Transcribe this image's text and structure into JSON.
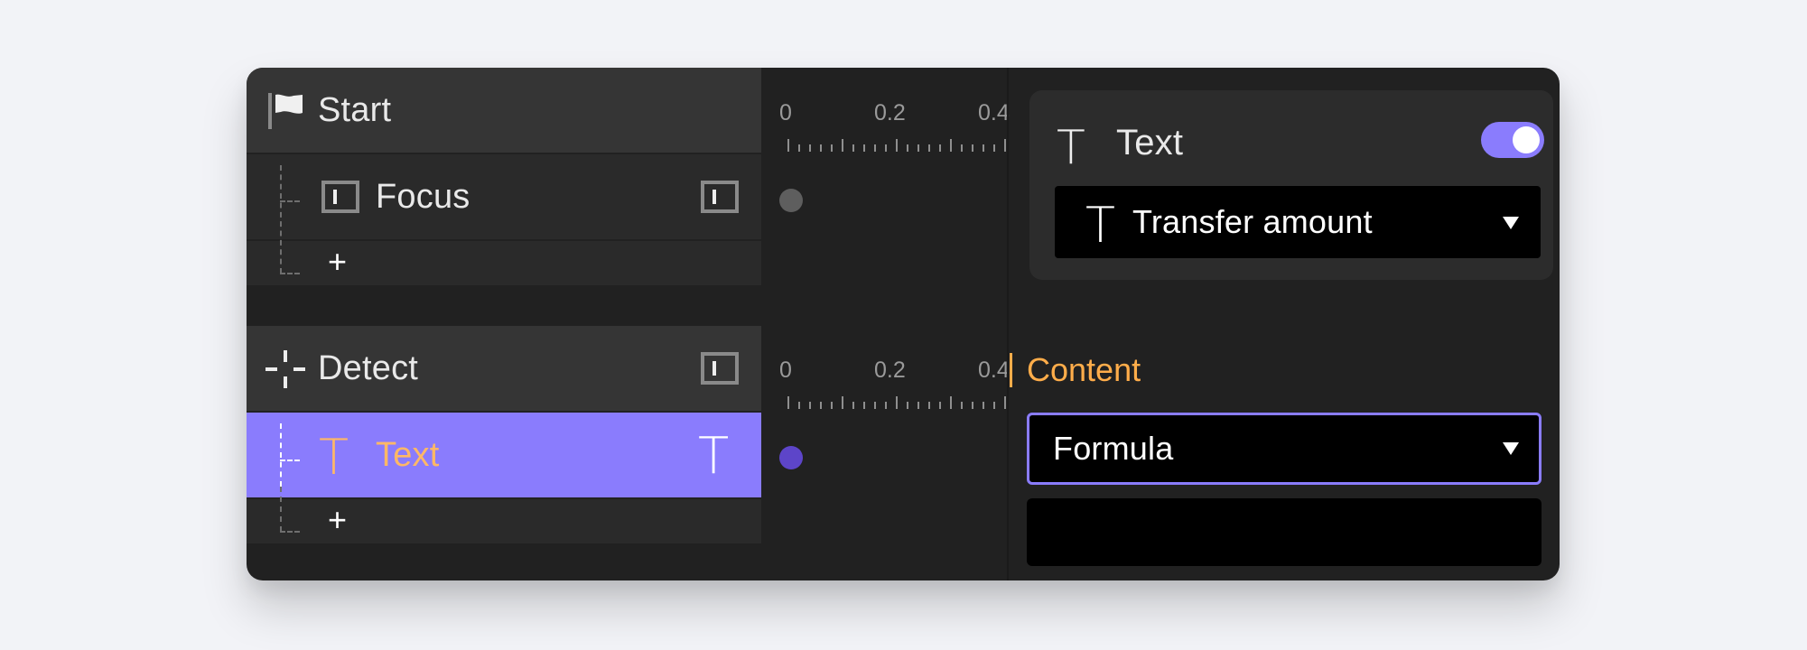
{
  "left_panel": {
    "groups": [
      {
        "header": {
          "label": "Start",
          "icon": "flag-icon"
        },
        "children": [
          {
            "label": "Focus",
            "icon": "frame-icon",
            "trailing_icon": "frame-icon",
            "selected": false
          }
        ],
        "add_label": "+"
      },
      {
        "header": {
          "label": "Detect",
          "icon": "crosshair-icon",
          "trailing_icon": "frame-icon"
        },
        "children": [
          {
            "label": "Text",
            "icon": "text-icon",
            "trailing_icon": "text-icon",
            "selected": true
          }
        ],
        "add_label": "+"
      }
    ]
  },
  "timeline": {
    "tick_labels": [
      "0",
      "0.2",
      "0.4"
    ],
    "dot_colors": {
      "default": "#5e5e5e",
      "selected": "#5d45c9"
    }
  },
  "inspector": {
    "node": {
      "icon": "text-icon",
      "title": "Text",
      "enabled": true,
      "variable_select": {
        "icon": "text-icon",
        "value": "Transfer amount"
      }
    },
    "content": {
      "label": "Content",
      "mode_select": {
        "value": "Formula"
      },
      "formula_value": ""
    }
  },
  "colors": {
    "accent": "#8a7cfd",
    "highlight_text": "#ffb866",
    "content_label": "#ffad4a",
    "panel_bg": "#212121",
    "page_bg": "#f2f3f7"
  }
}
